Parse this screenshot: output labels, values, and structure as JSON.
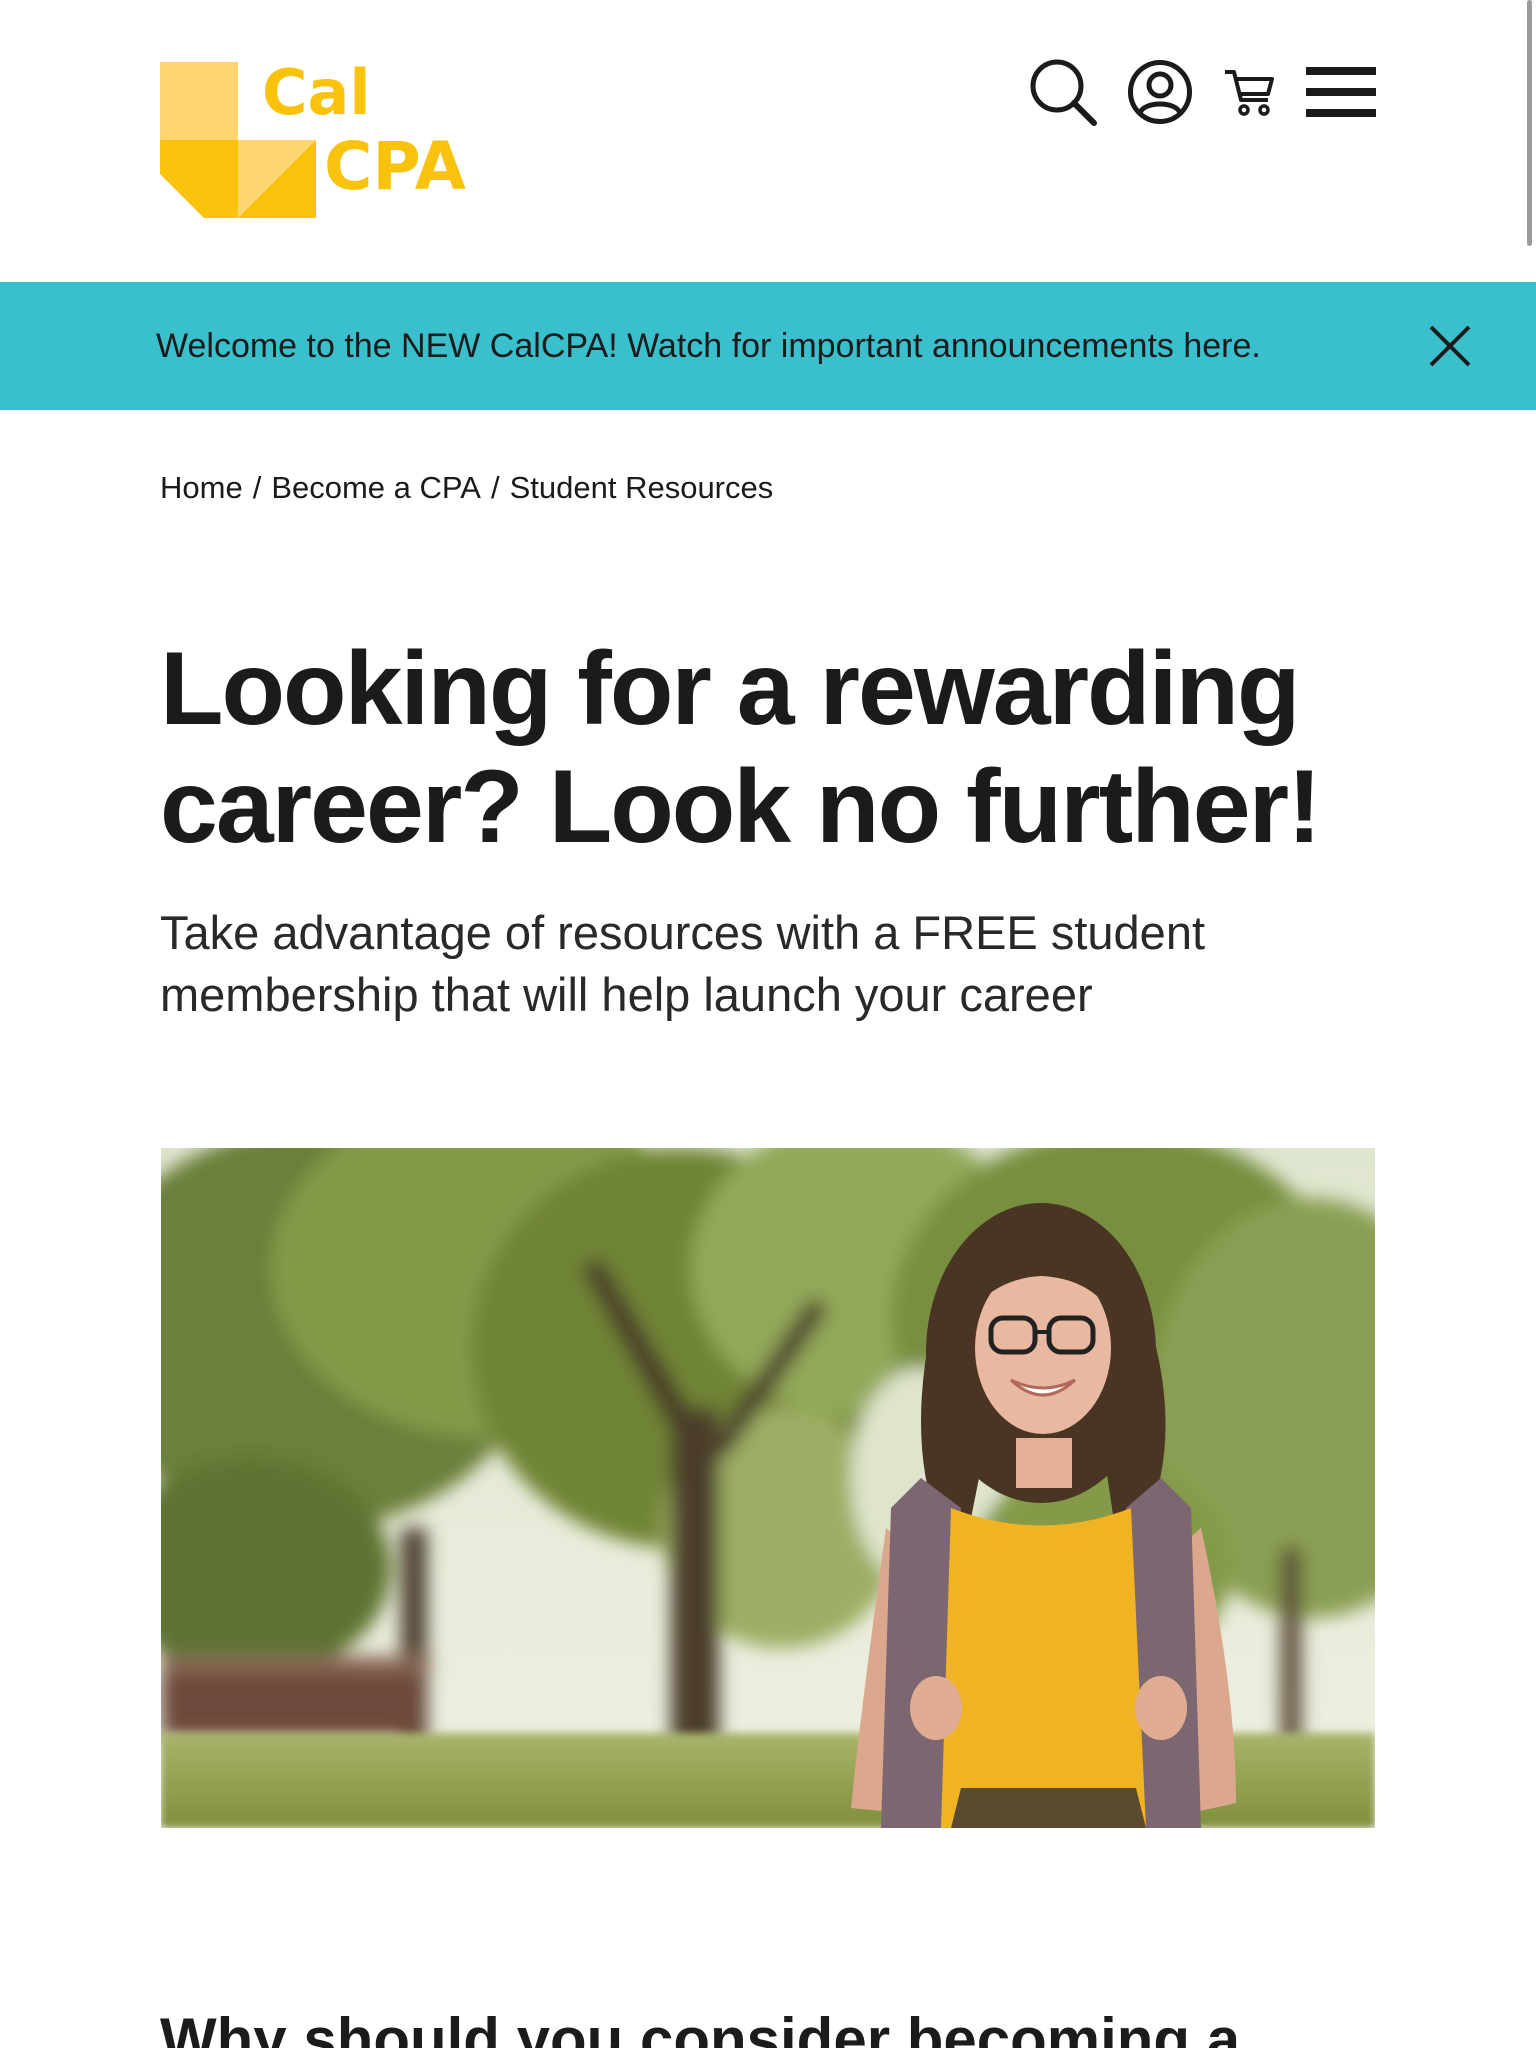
{
  "header": {
    "logo": {
      "line1": "Cal",
      "line2": "CPA",
      "color": "#f9c20d"
    },
    "tools": [
      {
        "icon": "search-icon"
      },
      {
        "icon": "account-icon"
      },
      {
        "icon": "cart-icon"
      },
      {
        "icon": "menu-icon"
      }
    ]
  },
  "announcement": {
    "text": "Welcome to the NEW CalCPA! Watch for important announcements here.",
    "background": "#3abfcd",
    "close_icon": "close-icon"
  },
  "breadcrumb": {
    "items": [
      "Home",
      "Become a CPA",
      "Student Resources"
    ],
    "separator": "/"
  },
  "hero": {
    "title": "Looking for a rewarding career? Look no further!",
    "subtitle": "Take advantage of resources with a FREE student membership that will help launch your career"
  },
  "next_section": {
    "title": "Why should you consider becoming a"
  }
}
